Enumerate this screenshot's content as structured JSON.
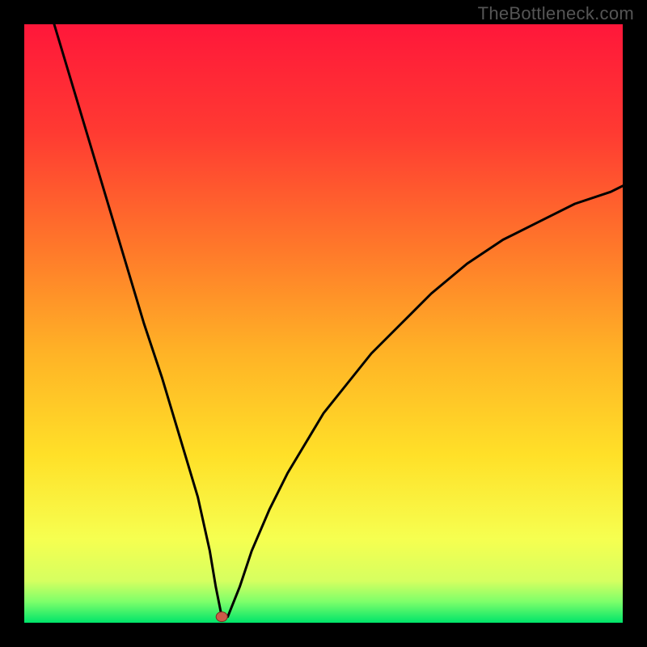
{
  "watermark": {
    "text": "TheBottleneck.com"
  },
  "colors": {
    "frame_bg": "#000000",
    "watermark": "#555555",
    "curve": "#000000",
    "marker_fill": "#cc5a49",
    "marker_stroke": "#7d2e22",
    "gradient_top": "#ff173a",
    "gradient_mid": "#ffd324",
    "gradient_bottom": "#00e46a",
    "green_band_top": "#f5ff8a",
    "green_band_bottom": "#00e46a"
  },
  "chart_data": {
    "type": "line",
    "title": "",
    "xlabel": "",
    "ylabel": "",
    "xlim": [
      0,
      100
    ],
    "ylim": [
      0,
      100
    ],
    "grid": false,
    "legend": false,
    "min_marker": {
      "x": 33,
      "y": 1
    },
    "series": [
      {
        "name": "bottleneck-curve",
        "x": [
          5,
          8,
          11,
          14,
          17,
          20,
          23,
          26,
          29,
          31,
          32,
          33,
          34,
          36,
          38,
          41,
          44,
          47,
          50,
          54,
          58,
          63,
          68,
          74,
          80,
          86,
          92,
          98,
          100
        ],
        "y": [
          100,
          90,
          80,
          70,
          60,
          50,
          41,
          31,
          21,
          12,
          6,
          1,
          1,
          6,
          12,
          19,
          25,
          30,
          35,
          40,
          45,
          50,
          55,
          60,
          64,
          67,
          70,
          72,
          73
        ]
      }
    ]
  }
}
